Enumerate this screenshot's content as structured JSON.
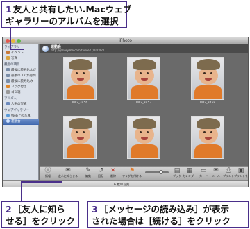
{
  "callouts": {
    "step1": {
      "num": "1",
      "line1": "友人と共有したい.Macウェブ",
      "line2": "ギャラリーのアルバムを選択"
    },
    "step2": {
      "num": "2",
      "line1": "［友人に知ら",
      "line2": "せる］をクリック"
    },
    "step3": {
      "num": "3",
      "line1": "［メッセージの読み込み］が表示",
      "line2": "された場合は［続ける］をクリック"
    }
  },
  "window": {
    "title": "iPhoto"
  },
  "sidebar": {
    "library_header": "ライブラリ",
    "library_items": [
      "イベント",
      "写真"
    ],
    "recent_header": "最近の項目",
    "recent_items": [
      "最後に読み込んだ",
      "最後の 12 か月間",
      "最後に読み込み",
      "フラグ付き",
      "ゴミ箱"
    ],
    "albums_header": "アルバム",
    "album_items": [
      "人形の写真"
    ],
    "web_header": "ウェブギャラリー",
    "web_items": [
      "Web上の写真",
      "運動会"
    ],
    "bottom_buttons": [
      "+",
      "⚙",
      "↻",
      "▸"
    ]
  },
  "album": {
    "name": "運動会",
    "url": "http://gallery.me.com/fumie77/100022"
  },
  "photos": [
    {
      "caption": "IMG_3456"
    },
    {
      "caption": "IMG_3457"
    },
    {
      "caption": "IMG_3458"
    },
    {
      "caption": ""
    },
    {
      "caption": ""
    },
    {
      "caption": ""
    }
  ],
  "toolbar": {
    "items": [
      {
        "icon": "info-icon",
        "glyph": "ⓘ",
        "label": "情報"
      },
      {
        "icon": "tell-friend-icon",
        "glyph": "✉",
        "label": "友人に知らせる"
      },
      {
        "icon": "edit-icon",
        "glyph": "✎",
        "label": "編集"
      },
      {
        "icon": "rotate-icon",
        "glyph": "↺",
        "label": "回転"
      },
      {
        "icon": "delete-icon",
        "glyph": "✕",
        "label": "削除"
      },
      {
        "icon": "flag-icon",
        "glyph": "⚑",
        "label": "フラグを付ける"
      },
      {
        "icon": "book-icon",
        "glyph": "▤",
        "label": "ブック"
      },
      {
        "icon": "calendar-icon",
        "glyph": "▦",
        "label": "カレンダー"
      },
      {
        "icon": "card-icon",
        "glyph": "▭",
        "label": "カード"
      },
      {
        "icon": "mail-icon",
        "glyph": "✉",
        "label": "メール"
      },
      {
        "icon": "print-icon",
        "glyph": "⎙",
        "label": "プリント"
      },
      {
        "icon": "order-prints-icon",
        "glyph": "▣",
        "label": "プリントを注文"
      }
    ]
  },
  "status": {
    "photo_count": "6 枚の写真"
  },
  "colors": {
    "callout_border": "#4a2f8a",
    "selection": "#3e66ad",
    "shirt": "#e07a2a"
  }
}
